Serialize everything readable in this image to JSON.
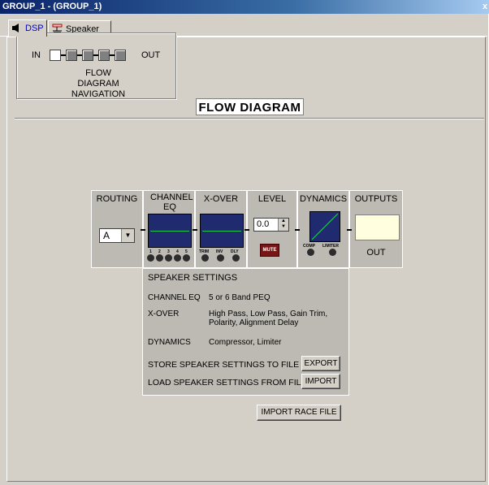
{
  "window": {
    "title": "GROUP_1 - (GROUP_1)",
    "close_glyph": "x"
  },
  "tabs": [
    {
      "label": "DSP",
      "icon": "speaker-mute-icon",
      "active": true
    },
    {
      "label": "Speaker",
      "icon": "speaker-settings-icon",
      "active": false
    }
  ],
  "nav": {
    "in_label": "IN",
    "out_label": "OUT",
    "caption_line1": "FLOW DIAGRAM",
    "caption_line2": "NAVIGATION"
  },
  "flow_title": "FLOW DIAGRAM",
  "stages": {
    "routing": {
      "title": "ROUTING",
      "value": "A"
    },
    "channel_eq": {
      "title": "CHANNEL EQ",
      "band_labels": [
        "1",
        "2",
        "3",
        "4",
        "5"
      ]
    },
    "xover": {
      "title": "X-OVER",
      "knob_labels": [
        "TRIM",
        "INV",
        "DLY"
      ]
    },
    "level": {
      "title": "LEVEL",
      "value": "0.0",
      "mute_label": "MUTE"
    },
    "dynamics": {
      "title": "DYNAMICS",
      "knob_labels": [
        "COMP",
        "LIMITER"
      ]
    },
    "outputs": {
      "title": "OUTPUTS",
      "value": "OUT"
    }
  },
  "speaker_settings": {
    "header": "SPEAKER SETTINGS",
    "rows": [
      {
        "label": "CHANNEL EQ",
        "value_line1": "5 or 6 Band PEQ",
        "value_line2": ""
      },
      {
        "label": "X-OVER",
        "value_line1": "High Pass, Low Pass, Gain Trim,",
        "value_line2": "Polarity, Alignment Delay"
      },
      {
        "label": "DYNAMICS",
        "value_line1": "Compressor, Limiter",
        "value_line2": ""
      }
    ],
    "store_label": "STORE SPEAKER SETTINGS TO FILE",
    "export_button": "EXPORT",
    "load_label": "LOAD SPEAKER SETTINGS FROM FILE",
    "import_button": "IMPORT"
  },
  "import_race_button": "IMPORT RACE FILE",
  "colors": {
    "screen": "#202a6e",
    "trace": "#22c84a",
    "mute": "#7a1414",
    "title_bar": "#0a246a"
  }
}
